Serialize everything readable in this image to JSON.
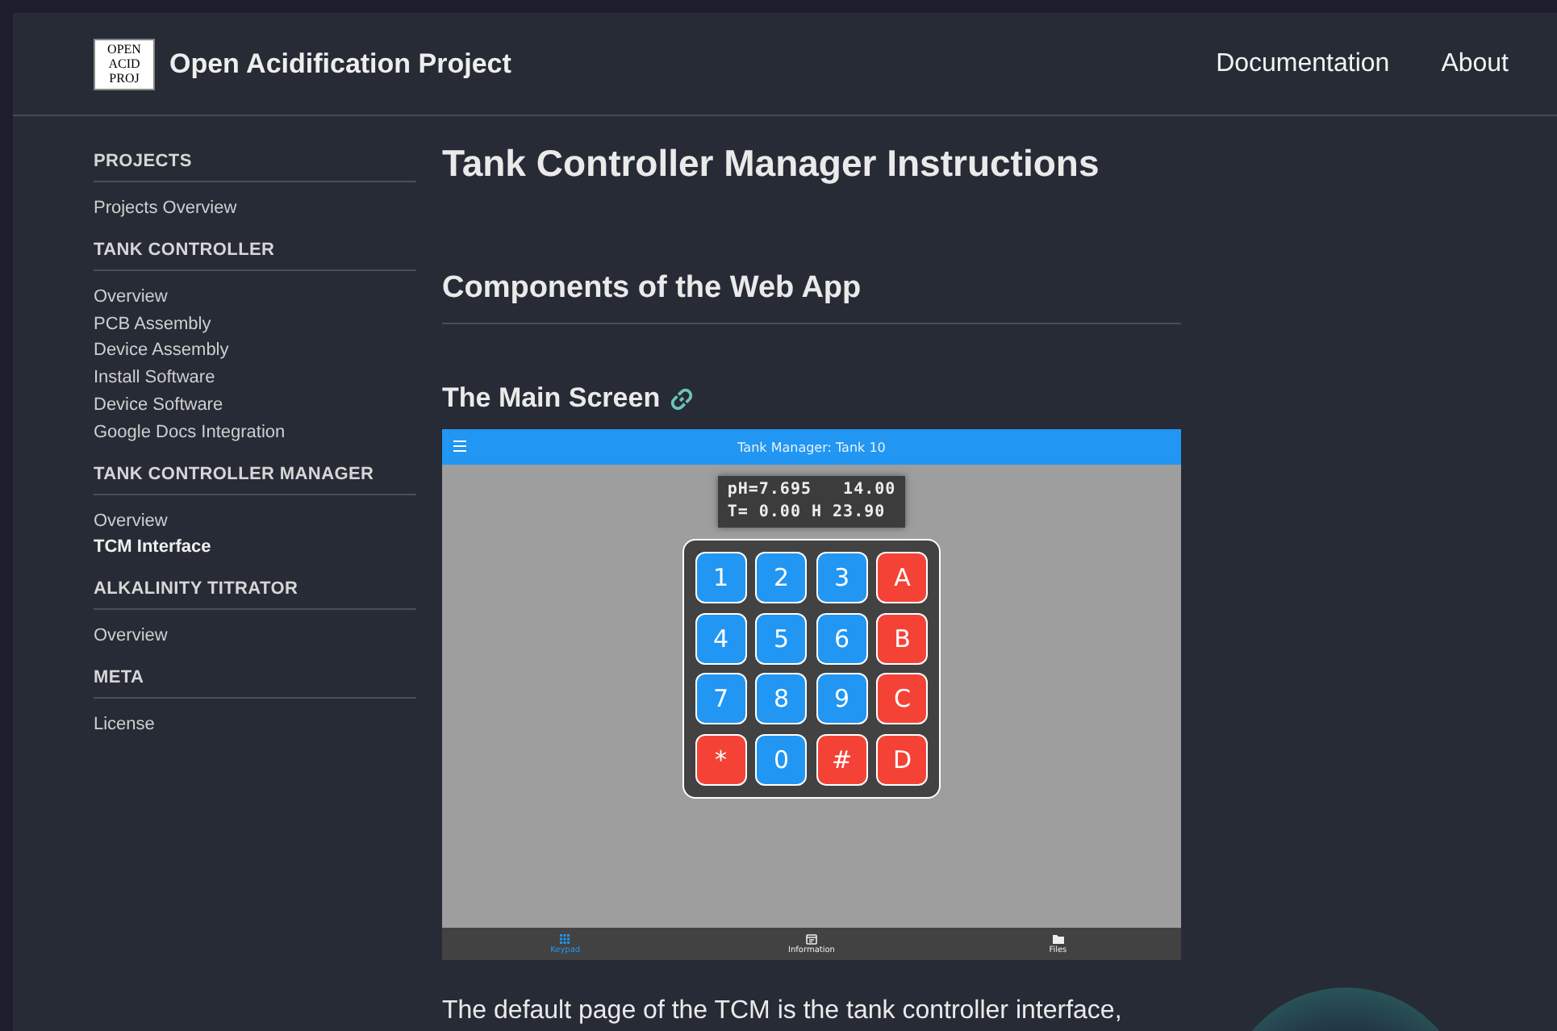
{
  "header": {
    "logo_text": [
      "OPEN",
      "ACID",
      "PROJ"
    ],
    "site_title": "Open Acidification Project",
    "nav": [
      "Documentation",
      "About"
    ]
  },
  "sidebar": {
    "sections": [
      {
        "title": "PROJECTS",
        "items": [
          {
            "label": "Projects Overview",
            "selected": false
          }
        ]
      },
      {
        "title": "TANK CONTROLLER",
        "items": [
          {
            "label": "Overview",
            "selected": false
          },
          {
            "label": "PCB Assembly",
            "selected": false
          },
          {
            "label": "Device Assembly",
            "selected": false
          },
          {
            "label": "Install Software",
            "selected": false
          },
          {
            "label": "Device Software",
            "selected": false
          },
          {
            "label": "Google Docs Integration",
            "selected": false
          }
        ]
      },
      {
        "title": "TANK CONTROLLER MANAGER",
        "items": [
          {
            "label": "Overview",
            "selected": false
          },
          {
            "label": "TCM Interface",
            "selected": true
          }
        ]
      },
      {
        "title": "ALKALINITY TITRATOR",
        "items": [
          {
            "label": "Overview",
            "selected": false
          }
        ]
      },
      {
        "title": "META",
        "items": [
          {
            "label": "License",
            "selected": false
          }
        ]
      }
    ]
  },
  "content": {
    "title": "Tank Controller Manager Instructions",
    "section_heading": "Components of the Web App",
    "subheading": "The Main Screen",
    "app_screenshot": {
      "app_bar_title": "Tank Manager: Tank 10",
      "lcd_lines": [
        "pH=7.695   14.00",
        "T= 0.00 H 23.90"
      ],
      "keys": [
        {
          "label": "1",
          "color": "#2196f3"
        },
        {
          "label": "2",
          "color": "#2196f3"
        },
        {
          "label": "3",
          "color": "#2196f3"
        },
        {
          "label": "A",
          "color": "#f44336"
        },
        {
          "label": "4",
          "color": "#2196f3"
        },
        {
          "label": "5",
          "color": "#2196f3"
        },
        {
          "label": "6",
          "color": "#2196f3"
        },
        {
          "label": "B",
          "color": "#f44336"
        },
        {
          "label": "7",
          "color": "#2196f3"
        },
        {
          "label": "8",
          "color": "#2196f3"
        },
        {
          "label": "9",
          "color": "#2196f3"
        },
        {
          "label": "C",
          "color": "#f44336"
        },
        {
          "label": "*",
          "color": "#f44336"
        },
        {
          "label": "0",
          "color": "#2196f3"
        },
        {
          "label": "#",
          "color": "#f44336"
        },
        {
          "label": "D",
          "color": "#f44336"
        }
      ],
      "bottom_nav": [
        {
          "label": "Keypad",
          "kind": "grid",
          "selected": true
        },
        {
          "label": "Information",
          "kind": "calendar",
          "selected": false
        },
        {
          "label": "Files",
          "kind": "folder",
          "selected": false
        }
      ]
    },
    "paragraph": "The default page of the TCM is the tank controller interface,"
  }
}
